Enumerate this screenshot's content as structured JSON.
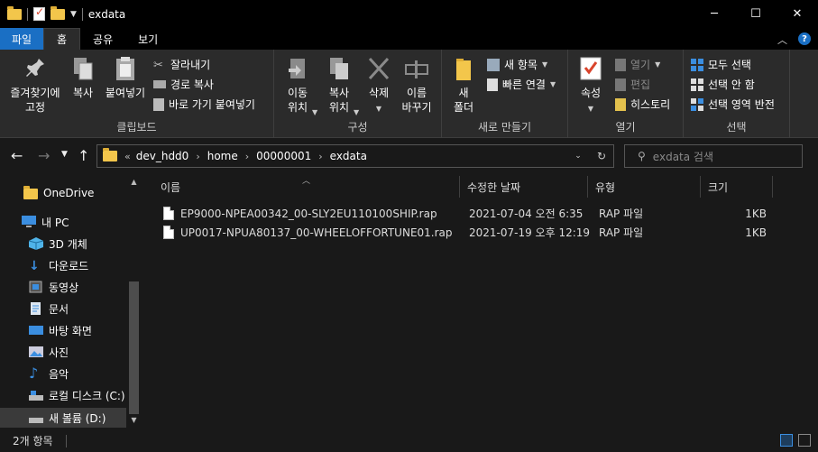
{
  "window": {
    "title": "exdata",
    "controls": {
      "minimize": "─",
      "maximize": "☐",
      "close": "✕"
    }
  },
  "ribbon_tabs": [
    {
      "label": "파일"
    },
    {
      "label": "홈"
    },
    {
      "label": "공유"
    },
    {
      "label": "보기"
    }
  ],
  "ribbon": {
    "clipboard": {
      "label": "클립보드",
      "pin_label": "즐겨찾기에\n고정",
      "copy_label": "복사",
      "paste_label": "붙여넣기",
      "cut_label": "잘라내기",
      "copy_path_label": "경로 복사",
      "paste_shortcut_label": "바로 가기 붙여넣기"
    },
    "organize": {
      "label": "구성",
      "move_label": "이동\n위치",
      "copy_to_label": "복사\n위치",
      "delete_label": "삭제",
      "rename_label": "이름\n바꾸기"
    },
    "new": {
      "label": "새로 만들기",
      "new_folder_label": "새\n폴더",
      "new_item_label": "새 항목",
      "easy_access_label": "빠른 연결"
    },
    "open": {
      "label": "열기",
      "properties_label": "속성",
      "open_label": "열기",
      "edit_label": "편집",
      "history_label": "히스토리"
    },
    "select": {
      "label": "선택",
      "select_all_label": "모두 선택",
      "select_none_label": "선택 안 함",
      "invert_label": "선택 영역 반전"
    }
  },
  "address": {
    "overflow": "«",
    "breadcrumbs": [
      "dev_hdd0",
      "home",
      "00000001",
      "exdata"
    ]
  },
  "search": {
    "placeholder": "exdata 검색"
  },
  "nav_pane": {
    "items": [
      {
        "label": "OneDrive",
        "icon": "onedrive-folder-icon"
      },
      {
        "label": "내 PC",
        "icon": "pc-icon"
      },
      {
        "label": "3D 개체",
        "icon": "3d-objects-icon"
      },
      {
        "label": "다운로드",
        "icon": "download-icon"
      },
      {
        "label": "동영상",
        "icon": "video-icon"
      },
      {
        "label": "문서",
        "icon": "document-icon"
      },
      {
        "label": "바탕 화면",
        "icon": "desktop-icon"
      },
      {
        "label": "사진",
        "icon": "pictures-icon"
      },
      {
        "label": "음악",
        "icon": "music-icon"
      },
      {
        "label": "로컬 디스크 (C:)",
        "icon": "disk-icon"
      },
      {
        "label": "새 볼륨 (D:)",
        "icon": "disk-icon"
      }
    ]
  },
  "file_list": {
    "columns": [
      "이름",
      "수정한 날짜",
      "유형",
      "크기"
    ],
    "rows": [
      {
        "name": "EP9000-NPEA00342_00-SLY2EU110100SHIP.rap",
        "modified": "2021-07-04 오전 6:35",
        "type": "RAP 파일",
        "size": "1KB"
      },
      {
        "name": "UP0017-NPUA80137_00-WHEELOFFORTUNE01.rap",
        "modified": "2021-07-19 오후 12:19",
        "type": "RAP 파일",
        "size": "1KB"
      }
    ]
  },
  "status": {
    "item_count": "2개 항목"
  },
  "colors": {
    "accent": "#1a6fc4",
    "folder": "#f3c64b",
    "background": "#191919",
    "ribbon": "#2b2b2b"
  }
}
